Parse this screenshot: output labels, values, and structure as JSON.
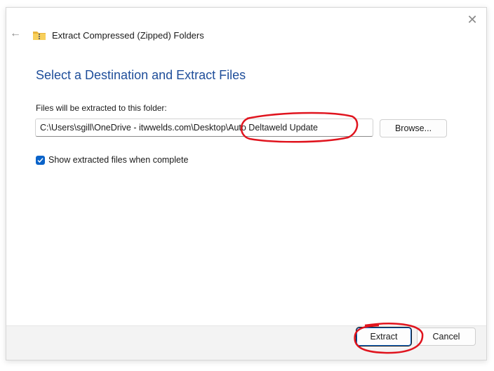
{
  "window": {
    "title": "Extract Compressed (Zipped) Folders",
    "close_glyph": "✕",
    "back_glyph": "←"
  },
  "main": {
    "heading": "Select a Destination and Extract Files",
    "field_label": "Files will be extracted to this folder:",
    "path_value": "C:\\Users\\sgill\\OneDrive - itwwelds.com\\Desktop\\Auto Deltaweld Update",
    "browse_label": "Browse...",
    "checkbox_label": "Show extracted files when complete",
    "checkbox_checked": true
  },
  "footer": {
    "extract_label": "Extract",
    "cancel_label": "Cancel"
  },
  "colors": {
    "heading": "#1f4e9a",
    "accent": "#0a63c9",
    "annotation": "#e0141e"
  },
  "icons": {
    "folder": "zip-folder-icon",
    "close": "close-icon",
    "back": "back-arrow-icon",
    "checkmark": "checkmark-icon"
  }
}
